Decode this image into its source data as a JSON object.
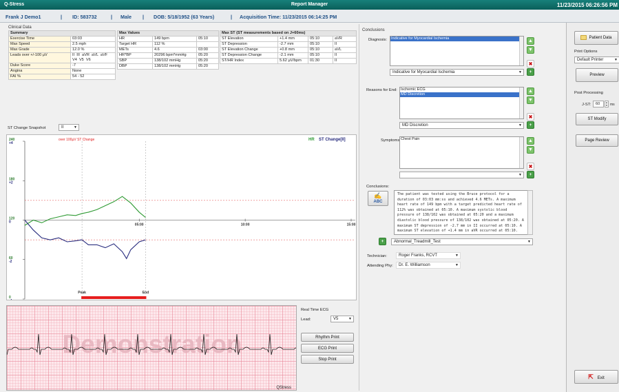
{
  "window": {
    "app_name": "Q-Stress",
    "title": "Report Manager",
    "clock": "11/23/2015 06:26:56 PM"
  },
  "patient": {
    "name": "Frank J Demo1",
    "id": "ID: 583732",
    "sex": "Male",
    "dob": "DOB: 5/18/1952 (63 Years)",
    "acquisition": "Acquisition Time: 11/23/2015 06:14:25 PM",
    "sep": "|"
  },
  "clinical": {
    "section_label": "Clinical Data",
    "summary_header": "Summary",
    "summary": [
      [
        "Exercise Time",
        "03:03"
      ],
      [
        "Max Speed",
        "2.5 mph"
      ],
      [
        "Max Grade",
        "12.0 %"
      ],
      [
        "Leads over +/-100 µV",
        "II  III  aVR  aVL  aVF\nV4  V5  V6"
      ],
      [
        "Duke Score",
        "-7"
      ],
      [
        "Angina",
        "None"
      ],
      [
        "FAI %",
        "54 - 52"
      ]
    ],
    "maxvals_header": "Max Values",
    "maxvals": [
      [
        "HR",
        "149 bpm",
        "05:10"
      ],
      [
        "Target HR",
        "112 %",
        ""
      ],
      [
        "METs",
        "4.6",
        "03:00"
      ],
      [
        "HR*BP",
        "20296 bpm*mmHg",
        "05:20"
      ],
      [
        "SBP",
        "138/102 mmHg",
        "05:20"
      ],
      [
        "DBP",
        "138/102 mmHg",
        "05:20"
      ]
    ],
    "maxst_header": "Max ST (ST measurements based on J+60ms)",
    "maxst": [
      [
        "ST Elevation",
        "+1.4 mm",
        "05:10",
        "aVR"
      ],
      [
        "ST Depression",
        "-2.7 mm",
        "05:10",
        "II"
      ],
      [
        "ST Elevation Change",
        "+0.8 mm",
        "05:10",
        "aVL"
      ],
      [
        "ST Depression Change",
        "-2.1 mm",
        "05:10",
        "II"
      ],
      [
        "ST/HR Index",
        "5.62 µV/bpm",
        "01:30",
        "II"
      ]
    ]
  },
  "snapshot": {
    "label": "ST Change Snapshot",
    "lead": "II"
  },
  "chart_data": {
    "type": "line",
    "legend_hr": "HR",
    "legend_st": "ST Change[II]",
    "annotation": "over 100µV ST Change",
    "y_ticks": [
      {
        "hr": "240",
        "st": "+4"
      },
      {
        "hr": "180",
        "st": "+2"
      },
      {
        "hr": "120",
        "st": "0"
      },
      {
        "hr": "60",
        "st": "-2"
      },
      {
        "hr": "0",
        "st": "-4"
      }
    ],
    "x_ticks": [
      "05:00",
      "10:00",
      "15:00"
    ],
    "markers": [
      {
        "label": "Peak",
        "t": 2.3
      },
      {
        "label": "End",
        "t": 5.3
      }
    ],
    "xlim": [
      -0.4,
      15
    ],
    "hr_ylim": [
      0,
      240
    ],
    "st_ylim": [
      -4,
      4
    ],
    "threshold_st": [
      1,
      -1
    ],
    "series": [
      {
        "name": "HR",
        "color": "#2e9a33",
        "t": [
          -0.4,
          0,
          0.4,
          0.8,
          1.2,
          1.6,
          2.0,
          2.3,
          2.6,
          3.0,
          3.4,
          3.8,
          4.2,
          4.6,
          5.0,
          5.3
        ],
        "values": [
          112,
          120,
          116,
          122,
          125,
          128,
          127,
          130,
          132,
          136,
          142,
          148,
          156,
          146,
          132,
          124
        ]
      },
      {
        "name": "ST Change[II]",
        "color": "#262a7d",
        "t": [
          -0.4,
          0,
          0.4,
          0.8,
          1.2,
          1.6,
          2.0,
          2.3,
          2.6,
          3.0,
          3.4,
          3.8,
          4.2,
          4.4,
          4.6,
          5.0,
          5.3
        ],
        "values": [
          0,
          -0.5,
          -0.9,
          -1.0,
          -0.9,
          -1.1,
          -1.05,
          -1.0,
          -1.25,
          -1.25,
          -1.4,
          -1.2,
          -1.6,
          -1.95,
          -1.5,
          -1.1,
          -1.0
        ]
      }
    ]
  },
  "ecg": {
    "watermark": "Demonstration",
    "brand": "QStress",
    "section_label": "Real Time ECG",
    "lead_label": "Lead:",
    "lead": "V5",
    "buttons": [
      "Rhythm Print",
      "ECG Print",
      "Stop Print"
    ]
  },
  "conclusions": {
    "section_label": "Conclusions",
    "diagnosis_label": "Diagnosis:",
    "diagnosis_items": [
      "Indicative for Myocardial Ischemia"
    ],
    "diagnosis_select": "Indicative for Myocardial Ischemia",
    "reasons_label": "Reasons for End:",
    "reasons_items": [
      "Ischemic ECG",
      "MD Discretion"
    ],
    "reasons_select": "MD Discretion",
    "symptoms_label": "Symptoms:",
    "symptoms_items": [
      "Chest Pain"
    ],
    "conclusions_label": "Conclusions:",
    "conclusion_text": "The patient was tested using the Bruce protocol for a duration of 03:03 mm:ss and achieved 4.6 METs. A maximum heart rate of 149 bpm with a target predicted heart rate of 112% was obtained at 05:10.  A maximum systolic blood pressure of 138/102 was obtained at 05:20 and a maximum diastolic blood pressure of 138/102 was obtained at 05:20. A maximum ST depression of -2.7 mm in II occurred at 05:10. A maximum ST elevation of +1.4 mm in aVR occurred at 05:10.  Exercise stress test indicative for myocardial",
    "abc_label": "ABC",
    "template": "Abnormal_Treadmill_Test",
    "technician_label": "Technician:",
    "technician": "Roger Franks, RCVT",
    "attending_label": "Attending Phy:",
    "attending": "Dr. E. Williamson"
  },
  "right": {
    "patient_data": "Patient Data",
    "print_options": "Print Options",
    "printer": "Default Printer",
    "preview": "Preview",
    "post_processing": "Post Processing",
    "jst_label": "J-ST:",
    "jst_value": "60",
    "jst_unit": "ms",
    "st_modify": "ST Modify",
    "page_review": "Page Review",
    "exit": "Exit"
  }
}
